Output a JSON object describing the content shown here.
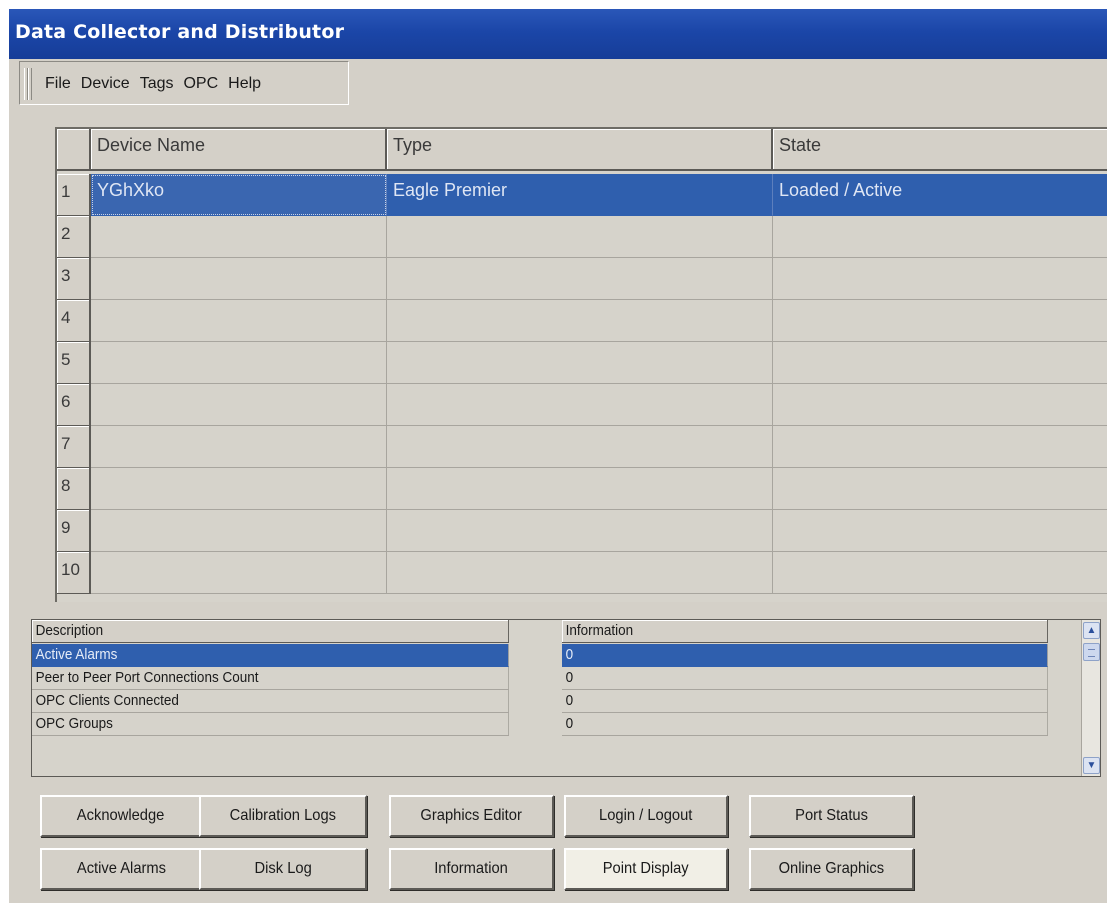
{
  "window": {
    "title": "Data Collector and Distributor"
  },
  "menu": [
    "File",
    "Device",
    "Tags",
    "OPC",
    "Help"
  ],
  "device_grid": {
    "columns": [
      "Device Name",
      "Type",
      "State"
    ],
    "rows": [
      {
        "num": "1",
        "name": "YGhXko",
        "type": "Eagle Premier",
        "state": "Loaded / Active",
        "selected": true
      },
      {
        "num": "2",
        "name": "",
        "type": "",
        "state": ""
      },
      {
        "num": "3",
        "name": "",
        "type": "",
        "state": ""
      },
      {
        "num": "4",
        "name": "",
        "type": "",
        "state": ""
      },
      {
        "num": "5",
        "name": "",
        "type": "",
        "state": ""
      },
      {
        "num": "6",
        "name": "",
        "type": "",
        "state": ""
      },
      {
        "num": "7",
        "name": "",
        "type": "",
        "state": ""
      },
      {
        "num": "8",
        "name": "",
        "type": "",
        "state": ""
      },
      {
        "num": "9",
        "name": "",
        "type": "",
        "state": ""
      },
      {
        "num": "10",
        "name": "",
        "type": "",
        "state": ""
      }
    ]
  },
  "info_list": {
    "columns": [
      "Description",
      "Information"
    ],
    "rows": [
      {
        "description": "Active Alarms",
        "information": "0",
        "selected": true
      },
      {
        "description": "Peer to Peer Port Connections Count",
        "information": "0"
      },
      {
        "description": "OPC Clients Connected",
        "information": "0"
      },
      {
        "description": "OPC Groups",
        "information": "0"
      }
    ]
  },
  "buttons": {
    "row1": [
      "Acknowledge",
      "Calibration Logs",
      "Graphics Editor",
      "Login / Logout",
      "Port Status"
    ],
    "row2": [
      "Active Alarms",
      "Disk Log",
      "Information",
      "Point Display",
      "Online Graphics"
    ],
    "active": "Point Display"
  },
  "colors": {
    "titlebar": "#1b46a8",
    "selection": "#2f5fae",
    "face": "#d4d0c8"
  }
}
